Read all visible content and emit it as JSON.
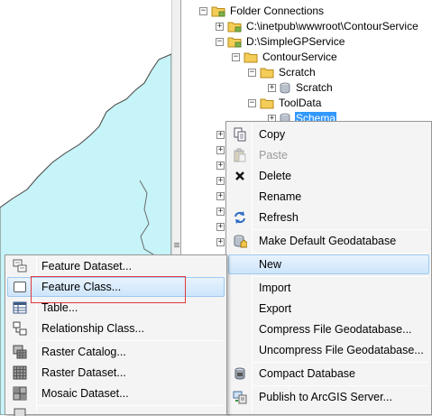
{
  "tree": {
    "items": [
      {
        "label": "Folder Connections",
        "expander": "−"
      },
      {
        "label": "C:\\inetpub\\wwwroot\\ContourService",
        "expander": "+"
      },
      {
        "label": "D:\\SimpleGPService",
        "expander": "−"
      },
      {
        "label": "ContourService",
        "expander": "−"
      },
      {
        "label": "Scratch",
        "expander": "−"
      },
      {
        "label": "Scratch",
        "expander": "+"
      },
      {
        "label": "ToolData",
        "expander": "−"
      },
      {
        "label": "Schema",
        "expander": "+"
      }
    ],
    "stub_expander": "+"
  },
  "context_menu": {
    "copy": "Copy",
    "paste": "Paste",
    "delete": "Delete",
    "rename": "Rename",
    "refresh": "Refresh",
    "make_default": "Make Default Geodatabase",
    "new": "New",
    "import": "Import",
    "export": "Export",
    "compress": "Compress File Geodatabase...",
    "uncompress": "Uncompress File Geodatabase...",
    "compact": "Compact Database",
    "publish": "Publish to ArcGIS Server..."
  },
  "submenu": {
    "feature_dataset": "Feature Dataset...",
    "feature_class": "Feature Class...",
    "table": "Table...",
    "relationship_class": "Relationship Class...",
    "raster_catalog": "Raster Catalog...",
    "raster_dataset": "Raster Dataset...",
    "mosaic_dataset": "Mosaic Dataset..."
  },
  "colors": {
    "selection": "#3399ff",
    "folder": "#f3cd57",
    "highlight_border": "#9ccaf0",
    "annotation_box": "#e0373f",
    "map_water": "#c6f4f8"
  }
}
